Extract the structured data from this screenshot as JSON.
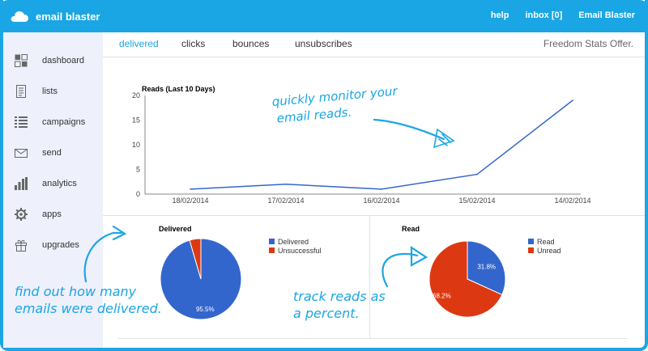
{
  "app": {
    "name": "email blaster",
    "accent": "#1aa6e4"
  },
  "topnav": {
    "help": "help",
    "inbox": "inbox [0]",
    "account": "Email Blaster"
  },
  "sidebar": {
    "items": [
      {
        "label": "dashboard",
        "icon": "dashboard-icon"
      },
      {
        "label": "lists",
        "icon": "list-doc-icon"
      },
      {
        "label": "campaigns",
        "icon": "campaigns-list-icon"
      },
      {
        "label": "send",
        "icon": "envelope-icon"
      },
      {
        "label": "analytics",
        "icon": "bar-chart-icon"
      },
      {
        "label": "apps",
        "icon": "gear-icon"
      },
      {
        "label": "upgrades",
        "icon": "gift-icon"
      }
    ]
  },
  "tabs": [
    {
      "label": "delivered",
      "active": true
    },
    {
      "label": "clicks",
      "active": false
    },
    {
      "label": "bounces",
      "active": false
    },
    {
      "label": "unsubscribes",
      "active": false
    }
  ],
  "offer": "Freedom Stats Offer.",
  "annotations": {
    "line": [
      "quickly monitor your",
      "email reads."
    ],
    "delivered": [
      "find out how many",
      "emails were delivered."
    ],
    "read": [
      "track reads as",
      "a percent."
    ]
  },
  "chart_data": [
    {
      "type": "line",
      "title": "Reads (Last 10 Days)",
      "x": [
        "18/02/2014",
        "17/02/2014",
        "16/02/2014",
        "15/02/2014",
        "14/02/2014"
      ],
      "series": [
        {
          "values": [
            1,
            2,
            1,
            4,
            19
          ],
          "color": "#3366cc"
        }
      ],
      "ylim": [
        0,
        20
      ],
      "yticks": [
        0,
        5,
        10,
        15,
        20
      ],
      "grid": false,
      "legend": "none"
    },
    {
      "type": "pie",
      "title": "Delivered",
      "slices": [
        {
          "label": "Delivered",
          "value": 95.5,
          "color": "#3366cc",
          "text": "95.5%"
        },
        {
          "label": "Unsuccessful",
          "value": 4.5,
          "color": "#dc3912",
          "text": ""
        }
      ],
      "legend": "right"
    },
    {
      "type": "pie",
      "title": "Read",
      "slices": [
        {
          "label": "Read",
          "value": 31.8,
          "color": "#3366cc",
          "text": "31.8%"
        },
        {
          "label": "Unread",
          "value": 68.2,
          "color": "#dc3912",
          "text": "68.2%"
        }
      ],
      "legend": "right"
    }
  ]
}
